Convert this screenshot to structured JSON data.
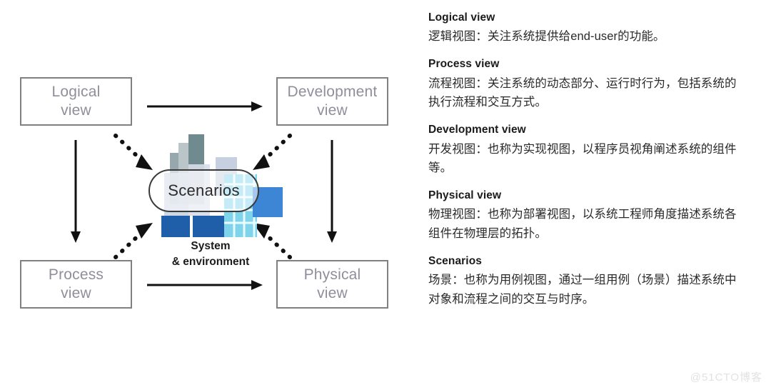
{
  "diagram": {
    "boxes": {
      "logical": {
        "line1": "Logical",
        "line2": "view"
      },
      "development": {
        "line1": "Development",
        "line2": "view"
      },
      "process": {
        "line1": "Process",
        "line2": "view"
      },
      "physical": {
        "line1": "Physical",
        "line2": "view"
      }
    },
    "center": {
      "scenarios_label": "Scenarios",
      "caption_line1": "System",
      "caption_line2": "& environment"
    },
    "colors": {
      "box_border": "#808080",
      "box_text": "#8f8f9c",
      "arrow": "#111111",
      "pill_border": "#3a3a3a",
      "building_dark_blue": "#1f5fa9",
      "building_mid_blue": "#3d86d6",
      "building_light_blue": "#a9d7ee",
      "building_pale": "#c3cede",
      "building_gray_green": "#6f8b8f"
    }
  },
  "panel": {
    "entries": [
      {
        "title": "Logical view",
        "desc": "逻辑视图：关注系统提供给end-user的功能。"
      },
      {
        "title": "Process view",
        "desc": "流程视图：关注系统的动态部分、运行时行为，包括系统的执行流程和交互方式。"
      },
      {
        "title": "Development view",
        "desc": "开发视图：也称为实现视图，以程序员视角阐述系统的组件等。"
      },
      {
        "title": "Physical view",
        "desc": "物理视图：也称为部署视图，以系统工程师角度描述系统各组件在物理层的拓扑。"
      },
      {
        "title": "Scenarios",
        "desc": "场景：也称为用例视图，通过一组用例（场景）描述系统中对象和流程之间的交互与时序。"
      }
    ]
  },
  "watermark": {
    "text": "@51CTO博客"
  }
}
